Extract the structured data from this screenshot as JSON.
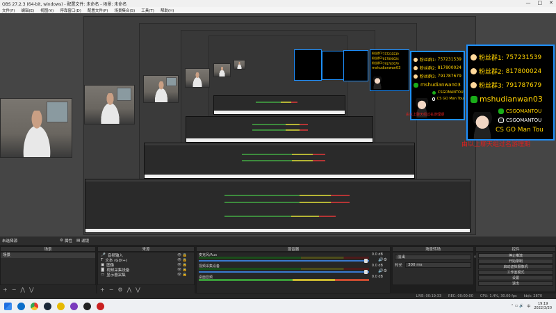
{
  "window": {
    "title": "OBS 27.2.3 (64-bit, windows) - 配置文件: 未命名 - 场景: 未命名"
  },
  "menu": [
    "文件(F)",
    "编辑(E)",
    "视图(V)",
    "停靠窗口(D)",
    "配置文件(P)",
    "场景集合(S)",
    "工具(T)",
    "帮助(H)"
  ],
  "info_panel": {
    "fan_group_1_label": "粉丝群1:",
    "fan_group_1": "757231539",
    "fan_group_2_label": "粉丝群2:",
    "fan_group_2": "817800024",
    "fan_group_3_label": "粉丝群3:",
    "fan_group_3": "791787679",
    "wechat": "mshudianwan03",
    "douyin": "CSGOMANTOU",
    "name": "CS GO Man Tou",
    "red_caption": "由以上聊天组过名游理期"
  },
  "scene_bar": {
    "label": "未选择源",
    "properties": "属性",
    "filters": "滤镜"
  },
  "docks": {
    "scenes": {
      "title": "场景",
      "items": [
        "场景"
      ]
    },
    "sources": {
      "title": "来源",
      "items": [
        {
          "icon": "audio-icon",
          "label": "音频输入"
        },
        {
          "icon": "text-icon",
          "label": "文本 (GDI+)"
        },
        {
          "icon": "image-icon",
          "label": "图像"
        },
        {
          "icon": "camera-icon",
          "label": "视频采集设备"
        },
        {
          "icon": "monitor-icon",
          "label": "显示器采集"
        }
      ]
    },
    "mixer": {
      "title": "混音器",
      "tracks": [
        {
          "name": "麦克风/Aux",
          "db": "0.0 dB"
        },
        {
          "name": "视频采集设备",
          "db": "0.0 dB"
        },
        {
          "name": "桌面音频",
          "db": "0.0 dB"
        }
      ]
    },
    "transitions": {
      "title": "场景转场",
      "type": "淡出",
      "duration_label": "时长",
      "duration": "300 ms"
    },
    "controls": {
      "title": "控件",
      "buttons": [
        "停止推流",
        "开始录制",
        "启动虚拟摄像机",
        "工作室模式",
        "设置",
        "退出"
      ]
    }
  },
  "status": {
    "live": "LIVE: 00:19:33",
    "rec": "REC: 00:00:00",
    "cpu": "CPU: 1.4%, 30.00 fps",
    "kbps": "kb/s: 2870"
  },
  "taskbar": {
    "time": "19:19",
    "date": "2022/3/20",
    "lang": "中"
  },
  "colors": {
    "panel_border": "#1e90ff",
    "panel_text": "#ffd200",
    "red_caption": "#e0201f",
    "wechat": "#1aad19"
  }
}
